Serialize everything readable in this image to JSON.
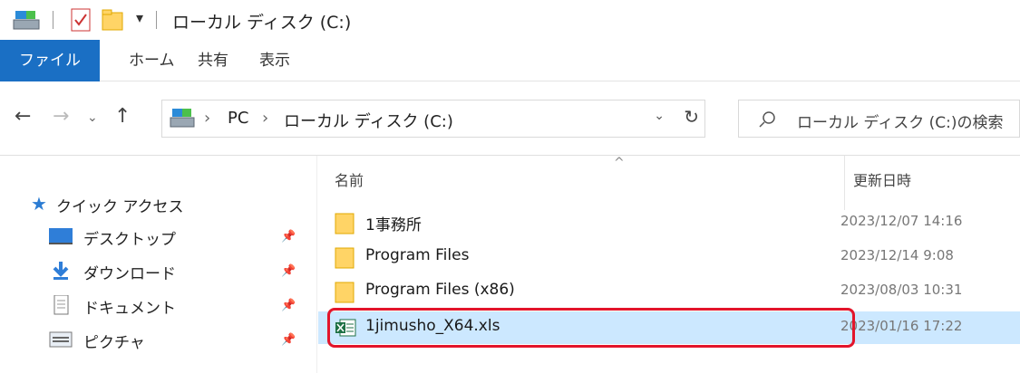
{
  "window": {
    "title": "ローカル ディスク (C:)"
  },
  "ribbon": {
    "tabs": [
      "ファイル",
      "ホーム",
      "共有",
      "表示"
    ]
  },
  "address": {
    "segments": [
      "PC",
      "ローカル ディスク (C:)"
    ],
    "separator": "›"
  },
  "search": {
    "placeholder": "ローカル ディスク (C:)の検索"
  },
  "nav": {
    "quick_access": "クイック アクセス",
    "items": [
      {
        "label": "デスクトップ",
        "icon": "desktop-icon"
      },
      {
        "label": "ダウンロード",
        "icon": "download-icon"
      },
      {
        "label": "ドキュメント",
        "icon": "document-icon"
      },
      {
        "label": "ピクチャ",
        "icon": "picture-icon"
      }
    ]
  },
  "list": {
    "col_name": "名前",
    "col_date": "更新日時",
    "rows": [
      {
        "name": "1事務所",
        "date": "2023/12/07 14:16",
        "type": "folder"
      },
      {
        "name": "Program Files",
        "date": "2023/12/14 9:08",
        "type": "folder"
      },
      {
        "name": "Program Files (x86)",
        "date": "2023/08/03 10:31",
        "type": "folder"
      },
      {
        "name": "1jimusho_X64.xls",
        "date": "2023/01/16 17:22",
        "type": "excel"
      }
    ]
  },
  "colors": {
    "accent": "#1a6fc4",
    "highlight": "#e3152b",
    "selected": "#cce8ff"
  }
}
